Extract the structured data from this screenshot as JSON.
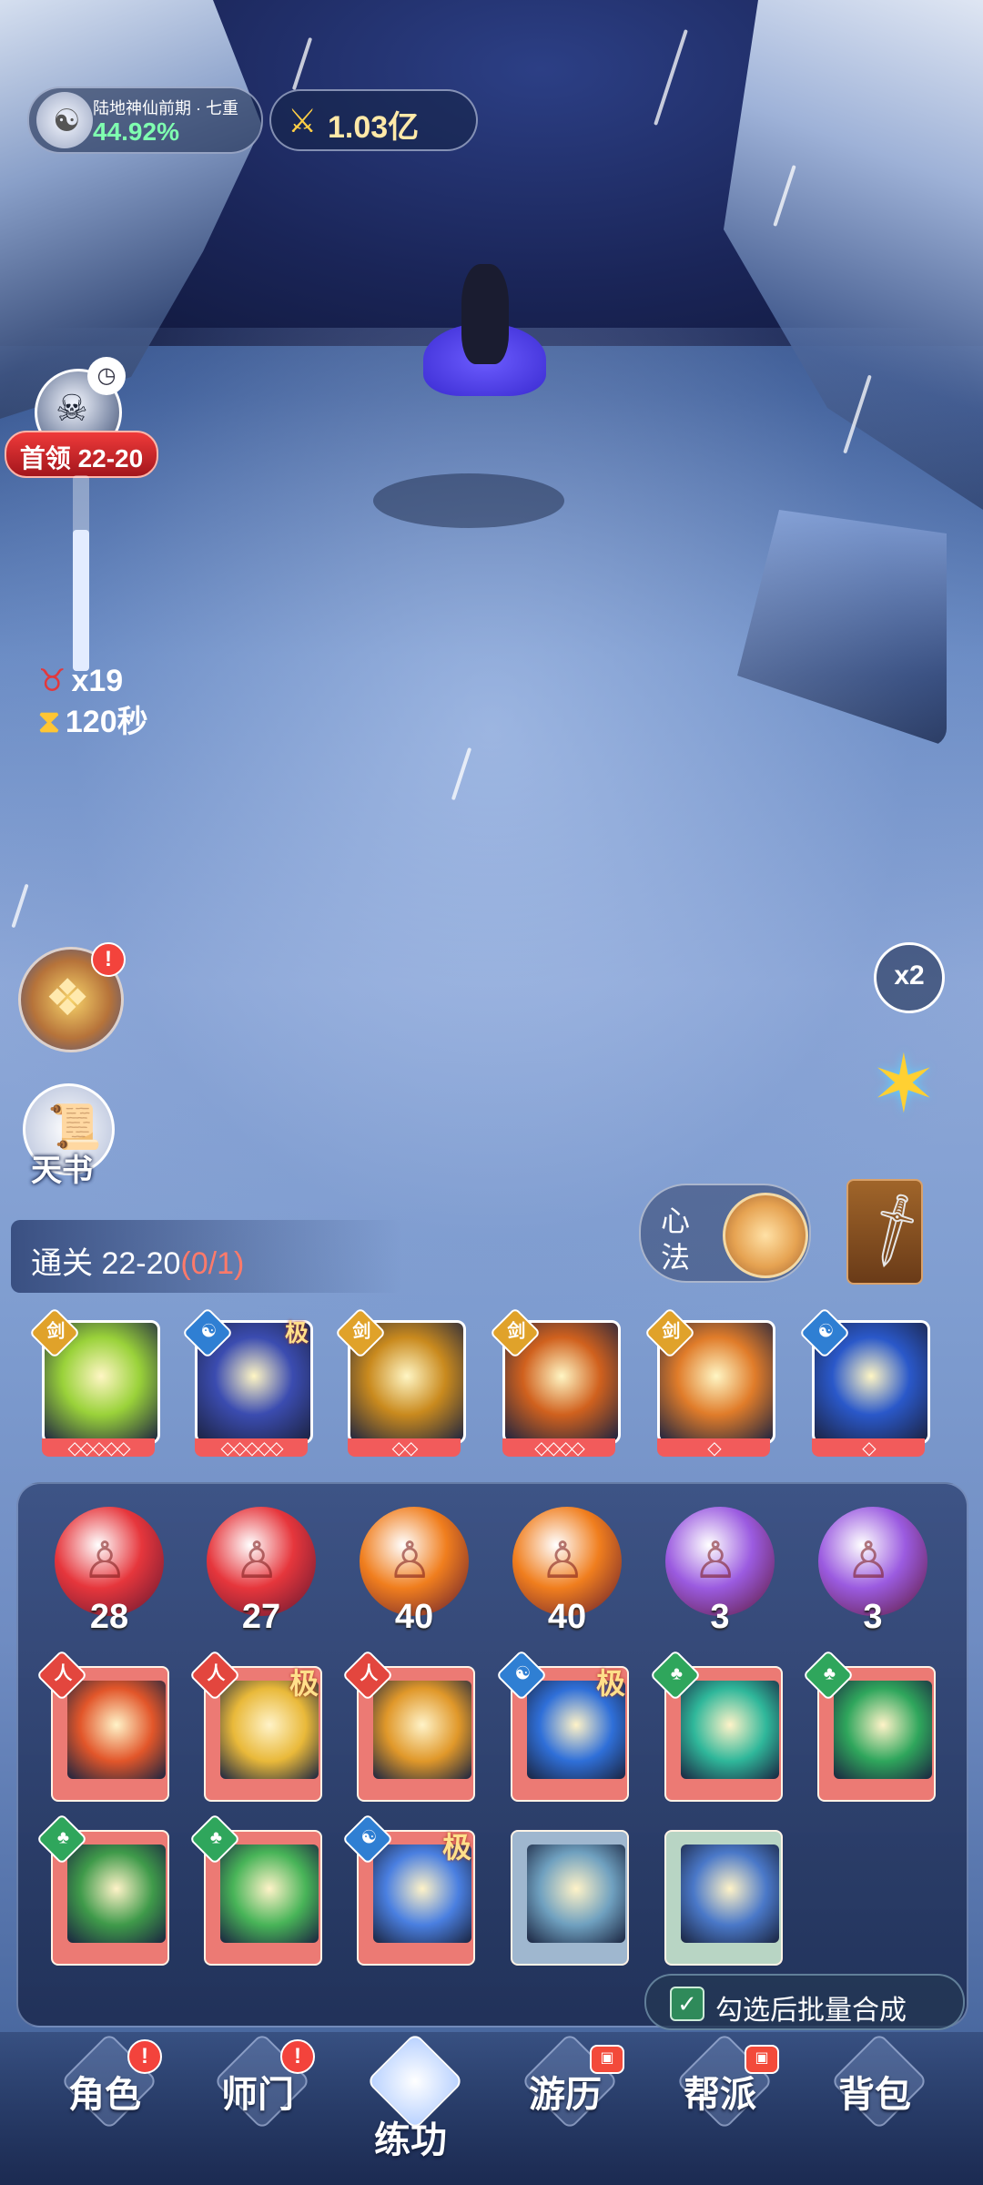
{
  "hud": {
    "cultivation_realm": "陆地神仙前期 · 七重",
    "cultivation_progress": "44.92%",
    "combat_power": "1.03亿"
  },
  "boss": {
    "label": "首领 22-20",
    "enemy_count": "x19",
    "time_left": "120秒",
    "progress_fraction": 0.72
  },
  "side": {
    "bag_badge": "!",
    "tianshu_label": "天书",
    "speed_label": "x2"
  },
  "stage": {
    "prefix": "通关",
    "level": "22-20",
    "progress": "(0/1)"
  },
  "xinfa": {
    "line1": "心",
    "line2": "法"
  },
  "equipped_skills": [
    {
      "element": "sword",
      "color": "#9ad23a",
      "levels": "◇◇◇◇◇",
      "ji": ""
    },
    {
      "element": "water",
      "color": "#3b4cb0",
      "levels": "◇◇◇◇◇",
      "ji": "极"
    },
    {
      "element": "sword",
      "color": "#c98a1e",
      "levels": "◇◇",
      "ji": ""
    },
    {
      "element": "sword",
      "color": "#d0611e",
      "levels": "◇◇◇◇",
      "ji": ""
    },
    {
      "element": "sword",
      "color": "#e07c2a",
      "levels": "◇",
      "ji": ""
    },
    {
      "element": "water",
      "color": "#2a58c9",
      "levels": "◇",
      "ji": ""
    }
  ],
  "orbs": [
    {
      "count": "28",
      "color": "#e6363c"
    },
    {
      "count": "27",
      "color": "#e6363c"
    },
    {
      "count": "40",
      "color": "#f07e1e"
    },
    {
      "count": "40",
      "color": "#f07e1e"
    },
    {
      "count": "3",
      "color": "#9b5be0"
    },
    {
      "count": "3",
      "color": "#9b5be0"
    }
  ],
  "skill_grid": [
    {
      "element": "body",
      "ji": ""
    },
    {
      "element": "body",
      "ji": "极"
    },
    {
      "element": "body",
      "ji": ""
    },
    {
      "element": "water",
      "ji": "极"
    },
    {
      "element": "wood",
      "ji": ""
    },
    {
      "element": "wood",
      "ji": ""
    },
    {
      "element": "wood",
      "ji": ""
    },
    {
      "element": "wood",
      "ji": ""
    },
    {
      "element": "water",
      "ji": "极"
    },
    {
      "element": "",
      "ji": ""
    },
    {
      "element": "",
      "ji": ""
    }
  ],
  "batch_merge_label": "勾选后批量合成",
  "nav": [
    {
      "label": "角色",
      "badge": "!"
    },
    {
      "label": "师门",
      "badge": "!"
    },
    {
      "label": "练功",
      "badge": ""
    },
    {
      "label": "游历",
      "badge": "chest"
    },
    {
      "label": "帮派",
      "badge": "chest"
    },
    {
      "label": "背包",
      "badge": ""
    }
  ],
  "icons": {
    "cultivation": "immortal-avatar-icon",
    "power": "crossed-swords-icon",
    "boss": "boss-head-icon",
    "enemy": "demon-head-icon",
    "timer": "hourglass-icon",
    "bag": "treasure-bag-icon",
    "tianshu": "scroll-book-icon",
    "star": "six-point-star-icon",
    "weapon": "blade-icon",
    "checkbox": "check-icon"
  }
}
